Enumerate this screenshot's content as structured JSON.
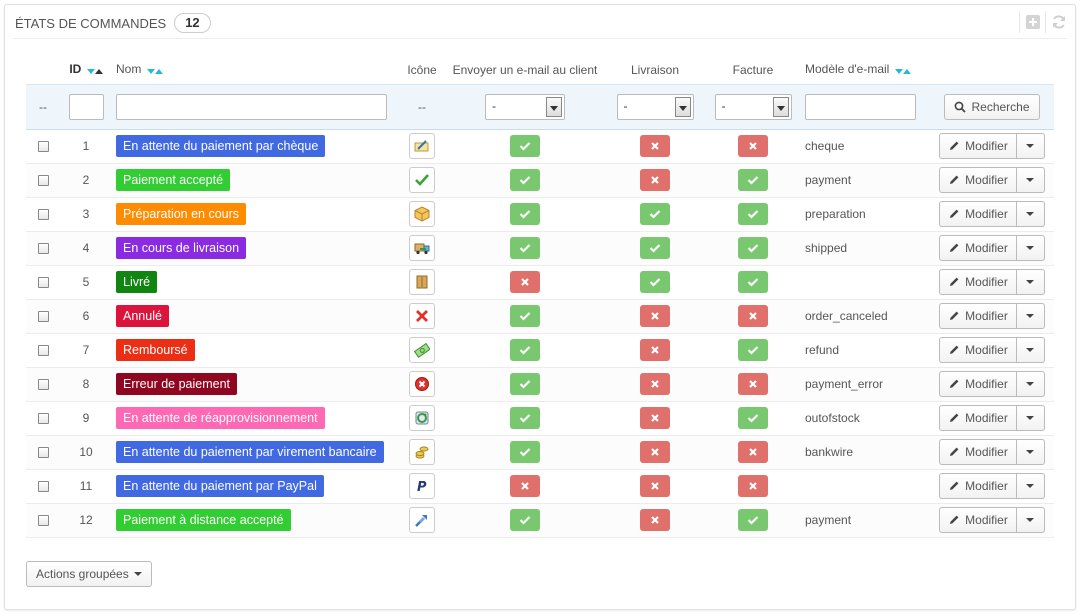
{
  "header": {
    "title": "États de commandes",
    "count": "12"
  },
  "columns": {
    "id": "ID",
    "name": "Nom",
    "icon": "Icône",
    "send_email": "Envoyer un e-mail au client",
    "delivery": "Livraison",
    "invoice": "Facture",
    "template": "Modèle d'e-mail"
  },
  "filters": {
    "checkbox_placeholder": "--",
    "icon_placeholder": "--",
    "send_email_value": "-",
    "delivery_value": "-",
    "invoice_value": "-",
    "search_label": "Recherche"
  },
  "rows": [
    {
      "id": "1",
      "name": "En attente du paiement par chèque",
      "color": "#4169e1",
      "icon": "cheque-icon",
      "send_email": true,
      "delivery": false,
      "invoice": false,
      "template": "cheque",
      "action": "Modifier"
    },
    {
      "id": "2",
      "name": "Paiement accepté",
      "color": "#32cd32",
      "icon": "check-icon",
      "send_email": true,
      "delivery": false,
      "invoice": true,
      "template": "payment",
      "action": "Modifier"
    },
    {
      "id": "3",
      "name": "Préparation en cours",
      "color": "#ff8c00",
      "icon": "package-icon",
      "send_email": true,
      "delivery": true,
      "invoice": true,
      "template": "preparation",
      "action": "Modifier"
    },
    {
      "id": "4",
      "name": "En cours de livraison",
      "color": "#8a2be2",
      "icon": "truck-icon",
      "send_email": true,
      "delivery": true,
      "invoice": true,
      "template": "shipped",
      "action": "Modifier"
    },
    {
      "id": "5",
      "name": "Livré",
      "color": "#108510",
      "icon": "box-icon",
      "send_email": false,
      "delivery": true,
      "invoice": true,
      "template": "",
      "action": "Modifier"
    },
    {
      "id": "6",
      "name": "Annulé",
      "color": "#dc143c",
      "icon": "cross-icon",
      "send_email": true,
      "delivery": false,
      "invoice": false,
      "template": "order_canceled",
      "action": "Modifier"
    },
    {
      "id": "7",
      "name": "Remboursé",
      "color": "#ec2e15",
      "icon": "money-icon",
      "send_email": true,
      "delivery": false,
      "invoice": true,
      "template": "refund",
      "action": "Modifier"
    },
    {
      "id": "8",
      "name": "Erreur de paiement",
      "color": "#8f0621",
      "icon": "error-icon",
      "send_email": true,
      "delivery": false,
      "invoice": false,
      "template": "payment_error",
      "action": "Modifier"
    },
    {
      "id": "9",
      "name": "En attente de réapprovisionnement",
      "color": "#ff69b4",
      "icon": "restock-icon",
      "send_email": true,
      "delivery": false,
      "invoice": true,
      "template": "outofstock",
      "action": "Modifier"
    },
    {
      "id": "10",
      "name": "En attente du paiement par virement bancaire",
      "color": "#4169e1",
      "icon": "coins-icon",
      "send_email": true,
      "delivery": false,
      "invoice": false,
      "template": "bankwire",
      "action": "Modifier"
    },
    {
      "id": "11",
      "name": "En attente du paiement par PayPal",
      "color": "#4169e1",
      "icon": "paypal-icon",
      "send_email": false,
      "delivery": false,
      "invoice": false,
      "template": "",
      "action": "Modifier"
    },
    {
      "id": "12",
      "name": "Paiement à distance accepté",
      "color": "#32cd32",
      "icon": "remote-payment-icon",
      "send_email": true,
      "delivery": false,
      "invoice": true,
      "template": "payment",
      "action": "Modifier"
    }
  ],
  "bulk_actions_label": "Actions groupées"
}
